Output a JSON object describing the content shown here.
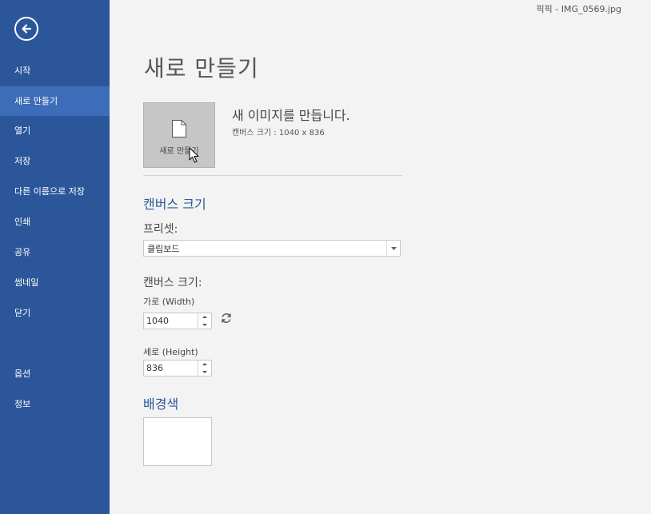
{
  "sidebar": {
    "items": [
      {
        "label": "시작"
      },
      {
        "label": "새로 만들기"
      },
      {
        "label": "열기"
      },
      {
        "label": "저장"
      },
      {
        "label": "다른 이름으로 저장"
      },
      {
        "label": "인쇄"
      },
      {
        "label": "공유"
      },
      {
        "label": "썸네일"
      },
      {
        "label": "닫기"
      },
      {
        "label": "옵션"
      },
      {
        "label": "정보"
      }
    ]
  },
  "header": {
    "document_title": "픽픽 - IMG_0569.jpg"
  },
  "main": {
    "title": "새로 만들기",
    "new_tile_label": "새로 만들기",
    "new_heading": "새 이미지를 만듭니다.",
    "canvas_info": "캔버스 크기 : 1040 x 836",
    "canvas_section": "캔버스 크기",
    "preset_label": "프리셋:",
    "preset_value": "클립보드",
    "canvas_size_label": "캔버스 크기:",
    "width_label": "가로 (Width)",
    "width_value": "1040",
    "height_label": "세로 (Height)",
    "height_value": "836",
    "bg_section": "배경색"
  },
  "colors": {
    "sidebar": "#2b579a",
    "sidebar_active": "#3d6cb9",
    "background": "#f3f3f3",
    "accent_text": "#2b579a",
    "bg_color_swatch": "#ffffff"
  },
  "icons": [
    "back-arrow-icon",
    "document-icon",
    "mouse-pointer-icon",
    "dropdown-arrow-icon",
    "spin-up-icon",
    "spin-down-icon",
    "refresh-icon"
  ]
}
